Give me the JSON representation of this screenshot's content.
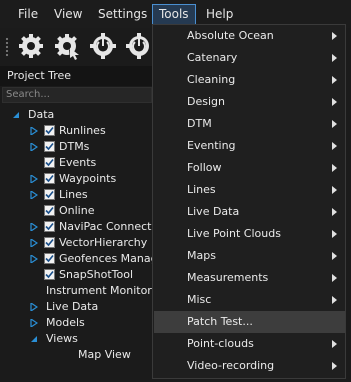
{
  "menubar": {
    "items": [
      {
        "label": "File"
      },
      {
        "label": "View"
      },
      {
        "label": "Settings"
      },
      {
        "label": "Tools"
      },
      {
        "label": "Help"
      }
    ]
  },
  "toolbar": {
    "icons": [
      "gear-icon",
      "gear-arrow-icon",
      "power-gear-icon",
      "power-gear-icon"
    ]
  },
  "project_tree": {
    "title": "Project Tree",
    "search_placeholder": "Search...",
    "nodes": [
      {
        "label": "Data",
        "expanded": true
      },
      {
        "label": "Runlines",
        "checked": true
      },
      {
        "label": "DTMs",
        "checked": true
      },
      {
        "label": "Events",
        "checked": true
      },
      {
        "label": "Waypoints",
        "checked": true
      },
      {
        "label": "Lines",
        "checked": true
      },
      {
        "label": "Online",
        "checked": true
      },
      {
        "label": "NaviPac Connection",
        "checked": true
      },
      {
        "label": "VectorHierarchy",
        "checked": true
      },
      {
        "label": "Geofences Manage",
        "checked": true
      },
      {
        "label": "SnapShotTool",
        "checked": true
      },
      {
        "label": "Instrument Monitor"
      },
      {
        "label": "Live Data"
      },
      {
        "label": "Models"
      },
      {
        "label": "Views",
        "expanded": true
      },
      {
        "label": "Map View"
      }
    ]
  },
  "tools_menu": {
    "items": [
      {
        "label": "Absolute Ocean",
        "submenu": true
      },
      {
        "label": "Catenary",
        "submenu": true
      },
      {
        "label": "Cleaning",
        "submenu": true
      },
      {
        "label": "Design",
        "submenu": true
      },
      {
        "label": "DTM",
        "submenu": true
      },
      {
        "label": "Eventing",
        "submenu": true
      },
      {
        "label": "Follow",
        "submenu": true
      },
      {
        "label": "Lines",
        "submenu": true
      },
      {
        "label": "Live Data",
        "submenu": true
      },
      {
        "label": "Live Point Clouds",
        "submenu": true
      },
      {
        "label": "Maps",
        "submenu": true
      },
      {
        "label": "Measurements",
        "submenu": true
      },
      {
        "label": "Misc",
        "submenu": true
      },
      {
        "label": "Patch Test...",
        "submenu": false,
        "highlighted": true
      },
      {
        "label": "Point-clouds",
        "submenu": true
      },
      {
        "label": "Video-recording",
        "submenu": true
      }
    ]
  },
  "colors": {
    "accent": "#2a8fd6",
    "menu_bg": "#1f1f1f",
    "highlight": "#3d3d3d"
  }
}
